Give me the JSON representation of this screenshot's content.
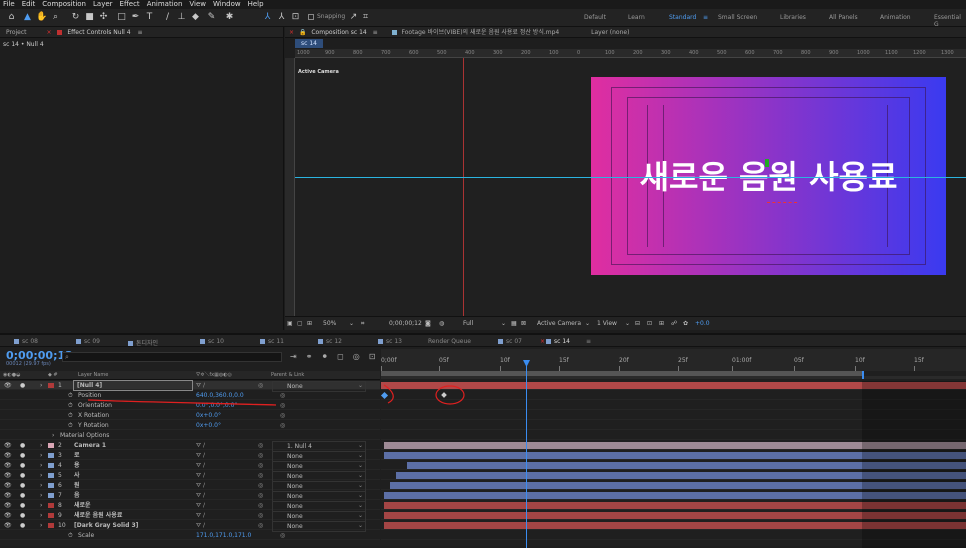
{
  "menu": [
    "File",
    "Edit",
    "Composition",
    "Layer",
    "Effect",
    "Animation",
    "View",
    "Window",
    "Help"
  ],
  "toolbar": {
    "snapping": "Snapping"
  },
  "workspaces": [
    {
      "label": "Default",
      "active": false
    },
    {
      "label": "Learn",
      "active": false
    },
    {
      "label": "Standard",
      "active": true
    },
    {
      "label": "Small Screen",
      "active": false
    },
    {
      "label": "Libraries",
      "active": false
    },
    {
      "label": "All Panels",
      "active": false
    },
    {
      "label": "Animation",
      "active": false
    },
    {
      "label": "Essential G",
      "active": false
    }
  ],
  "project": {
    "tab_project": "Project",
    "tab_effect": "Effect Controls Null 4",
    "breadcrumb": "sc 14 • Null 4"
  },
  "comp": {
    "tab_comp": "Composition sc 14",
    "tab_footage": "Footage 바이브(VIBE)의 새로운 음원 사용료 정산 방식.mp4",
    "tab_layer": "Layer (none)",
    "subtab": "sc 14",
    "active_camera": "Active Camera",
    "title_text": "새로운 음원 사용료",
    "ruler": [
      "1000",
      "900",
      "800",
      "700",
      "600",
      "500",
      "400",
      "300",
      "200",
      "100",
      "0",
      "100",
      "200",
      "300",
      "400",
      "500",
      "600",
      "700",
      "800",
      "900",
      "1000",
      "1100",
      "1200",
      "1300"
    ],
    "footer": {
      "zoom": "50%",
      "time": "0;00;00;12",
      "quality": "Full",
      "camera": "Active Camera",
      "view": "1 View",
      "exposure": "+0.0"
    },
    "gradient": {
      "from": "#e02ea0",
      "to": "#3a3af0"
    }
  },
  "timeline": {
    "tabs": [
      {
        "label": "sc 08",
        "color": "#7f9fcf"
      },
      {
        "label": "sc 09",
        "color": "#7f9fcf"
      },
      {
        "label": "톤디자인",
        "color": "#7f9fcf"
      },
      {
        "label": "sc 10",
        "color": "#7f9fcf"
      },
      {
        "label": "sc 11",
        "color": "#7f9fcf"
      },
      {
        "label": "sc 12",
        "color": "#7f9fcf"
      },
      {
        "label": "sc 13",
        "color": "#7f9fcf"
      },
      {
        "label": "Render Queue",
        "color": ""
      },
      {
        "label": "sc 07",
        "color": "#7f9fcf"
      },
      {
        "label": "sc 14",
        "color": "#7f9fcf"
      }
    ],
    "timecode": "0;00;00;12",
    "fps": "00012 (29.97 fps)",
    "headers": {
      "layer_name": "Layer Name",
      "parent": "Parent & Link"
    },
    "ticks": [
      "0;00f",
      "05f",
      "10f",
      "15f",
      "20f",
      "25f",
      "01:00f",
      "05f",
      "10f",
      "15f"
    ],
    "layers": [
      {
        "num": "1",
        "name": "[Null 4]",
        "color": "#b03a3a",
        "parent": "None",
        "bar": "#b04848",
        "bar_start": 0,
        "type": "layer",
        "selected": true
      },
      {
        "num": "",
        "name": "Position",
        "color": "",
        "parent": "",
        "value": "640.0,360.0,0.0",
        "type": "prop"
      },
      {
        "num": "",
        "name": "Orientation",
        "color": "",
        "parent": "",
        "value": "0.0°,0.0°,0.0°",
        "type": "prop"
      },
      {
        "num": "",
        "name": "X Rotation",
        "color": "",
        "parent": "",
        "value": "0x+0.0°",
        "type": "prop"
      },
      {
        "num": "",
        "name": "Y Rotation",
        "color": "",
        "parent": "",
        "value": "0x+0.0°",
        "type": "prop"
      },
      {
        "num": "",
        "name": "Material Options",
        "color": "",
        "parent": "",
        "type": "group"
      },
      {
        "num": "2",
        "name": "Camera 1",
        "color": "#d9a6b5",
        "parent": "1. Null 4",
        "bar": "#9e8a95",
        "bar_start": 0.005,
        "type": "layer"
      },
      {
        "num": "3",
        "name": "로",
        "color": "#7f9fcf",
        "parent": "None",
        "bar": "#5c6fa6",
        "bar_start": 0.005,
        "type": "layer"
      },
      {
        "num": "4",
        "name": "용",
        "color": "#7f9fcf",
        "parent": "None",
        "bar": "#5c6fa6",
        "bar_start": 0.045,
        "type": "layer"
      },
      {
        "num": "5",
        "name": "사",
        "color": "#7f9fcf",
        "parent": "None",
        "bar": "#5c6fa6",
        "bar_start": 0.025,
        "type": "layer"
      },
      {
        "num": "6",
        "name": "원",
        "color": "#7f9fcf",
        "parent": "None",
        "bar": "#5c6fa6",
        "bar_start": 0.015,
        "type": "layer"
      },
      {
        "num": "7",
        "name": "음",
        "color": "#7f9fcf",
        "parent": "None",
        "bar": "#5c6fa6",
        "bar_start": 0.005,
        "type": "layer"
      },
      {
        "num": "8",
        "name": "새로운",
        "color": "#b03a3a",
        "parent": "None",
        "bar": "#a34545",
        "bar_start": 0.005,
        "type": "layer"
      },
      {
        "num": "9",
        "name": "새로운 음원 사용료",
        "color": "#b03a3a",
        "parent": "None",
        "bar": "#a34545",
        "bar_start": 0.005,
        "type": "layer"
      },
      {
        "num": "10",
        "name": "[Dark Gray Solid 3]",
        "color": "#b03a3a",
        "parent": "None",
        "bar": "#a34545",
        "bar_start": 0.005,
        "type": "layer"
      },
      {
        "num": "",
        "name": "Scale",
        "color": "",
        "parent": "",
        "value": "171.0,171.0,171.0",
        "type": "prop"
      }
    ]
  }
}
